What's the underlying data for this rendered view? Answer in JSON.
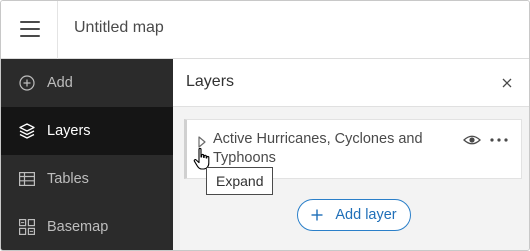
{
  "header": {
    "title": "Untitled map"
  },
  "sidebar": {
    "items": [
      {
        "label": "Add",
        "icon": "plus-circle-icon"
      },
      {
        "label": "Layers",
        "icon": "layers-icon"
      },
      {
        "label": "Tables",
        "icon": "table-icon"
      },
      {
        "label": "Basemap",
        "icon": "basemap-icon"
      }
    ],
    "active": "Layers"
  },
  "panel": {
    "title": "Layers",
    "layers": [
      {
        "title": "Active Hurricanes, Cyclones and Typhoons"
      }
    ],
    "tooltip": "Expand",
    "add_layer_label": "Add layer"
  },
  "colors": {
    "sidebar_bg": "#2b2b2b",
    "sidebar_active_bg": "#151515",
    "accent": "#1f6fb8"
  }
}
